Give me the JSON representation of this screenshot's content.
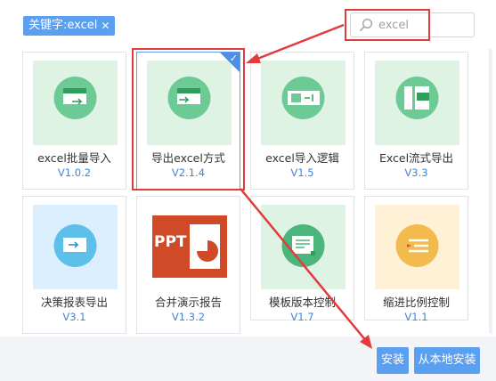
{
  "filter_tag": {
    "label": "关键字:excel",
    "close": "✕"
  },
  "search": {
    "value": "excel",
    "placeholder": "excel"
  },
  "plugins": [
    {
      "name": "excel批量导入",
      "version": "V1.0.2",
      "icon": "excel-import-icon"
    },
    {
      "name": "导出excel方式",
      "version": "V2.1.4",
      "icon": "excel-export-icon",
      "selected": true
    },
    {
      "name": "excel导入逻辑",
      "version": "V1.5",
      "icon": "excel-logic-icon"
    },
    {
      "name": "Excel流式导出",
      "version": "V3.3",
      "icon": "excel-stream-icon"
    },
    {
      "name": "决策报表导出",
      "version": "V3.1",
      "icon": "report-export-icon"
    },
    {
      "name": "合并演示报告",
      "version": "V1.3.2",
      "icon": "ppt-icon",
      "icon_text": "PPT"
    },
    {
      "name": "模板版本控制",
      "version": "V1.7",
      "icon": "template-version-icon"
    },
    {
      "name": "缩进比例控制",
      "version": "V1.1",
      "icon": "indent-scale-icon"
    }
  ],
  "buttons": {
    "install": "安装",
    "install_local": "从本地安装"
  },
  "colors": {
    "accent": "#5b9ff0",
    "highlight": "#e23b3b",
    "green": "#5cc68a",
    "blue": "#3aa3d9",
    "ppt": "#d04a28",
    "orange": "#f0a93a"
  }
}
